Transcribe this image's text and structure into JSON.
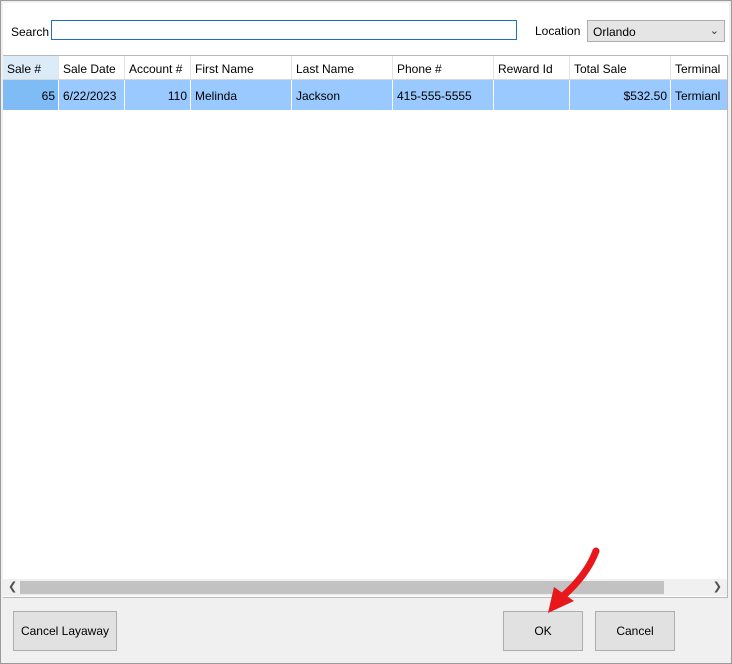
{
  "search": {
    "label": "Search",
    "value": "",
    "placeholder": ""
  },
  "location": {
    "label": "Location",
    "selected": "Orlando"
  },
  "table": {
    "columns": [
      "Sale #",
      "Sale Date",
      "Account #",
      "First Name",
      "Last Name",
      "Phone #",
      "Reward Id",
      "Total Sale",
      "Terminal"
    ],
    "sorted_column": "Sale #",
    "rows": [
      {
        "sale_no": "65",
        "sale_date": "6/22/2023",
        "account_no": "110",
        "first_name": "Melinda",
        "last_name": "Jackson",
        "phone": "415-555-5555",
        "reward_id": "",
        "total_sale": "$532.50",
        "terminal": "Termianl"
      }
    ],
    "selected_row_color": "#99c9ff"
  },
  "buttons": {
    "cancel_layaway": "Cancel Layaway",
    "ok": "OK",
    "cancel": "Cancel"
  },
  "annotation": {
    "arrow_color": "#e8171c",
    "points_to": "OK"
  }
}
